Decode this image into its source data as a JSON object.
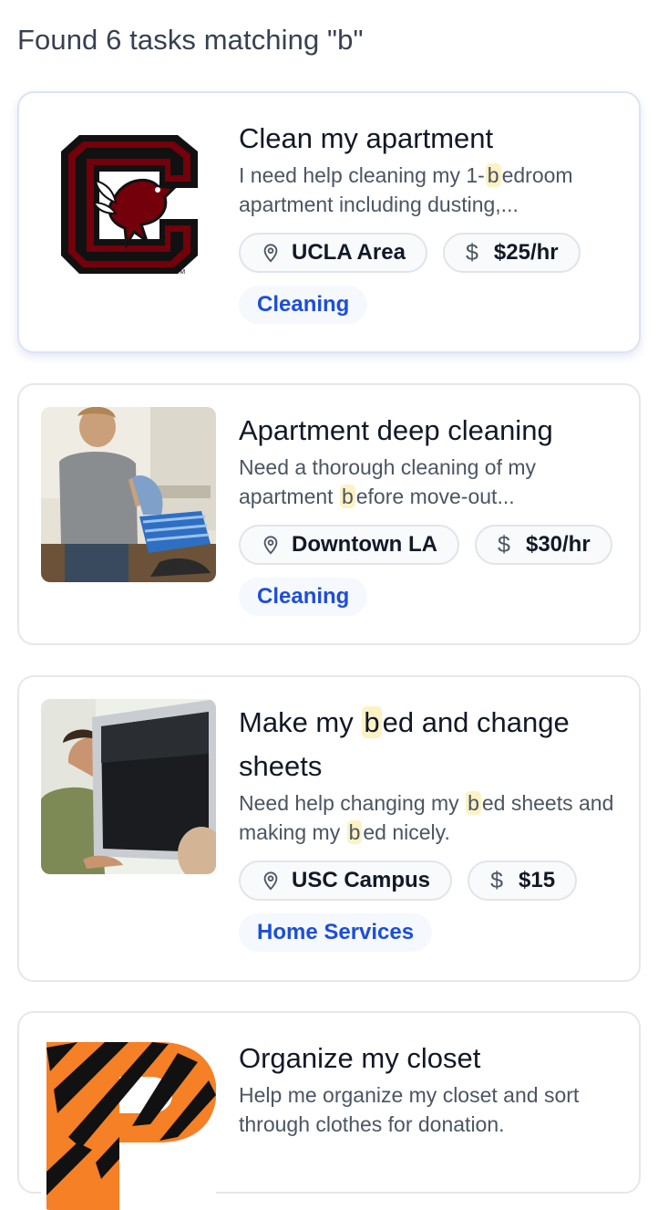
{
  "results": {
    "header": "Found 6 tasks matching \"b\""
  },
  "tasks": [
    {
      "title": "Clean my apartment",
      "desc_before": "I need help cleaning my 1-",
      "desc_hl": "b",
      "desc_after": "edroom apartment including dusting,...",
      "location": "UCLA Area",
      "rate": "$25/hr",
      "category": "Cleaning",
      "image": "gamecocks-logo"
    },
    {
      "title": "Apartment deep cleaning",
      "desc_before": "Need a thorough cleaning of my apartment ",
      "desc_hl": "b",
      "desc_after": "efore move-out...",
      "location": "Downtown LA",
      "rate": "$30/hr",
      "category": "Cleaning",
      "image": "man-doing-laundry-photo"
    },
    {
      "title_before": "Make my ",
      "title_hl": "b",
      "title_after": "ed and change sheets",
      "desc_1": "Need help changing my ",
      "desc_hl1": "b",
      "desc_2": "ed sheets and making my ",
      "desc_hl2": "b",
      "desc_3": "ed nicely.",
      "location": "USC Campus",
      "rate": "$15",
      "category": "Home Services",
      "image": "man-carrying-tv-photo"
    },
    {
      "title": "Organize my closet",
      "desc": "Help me organize my closet and sort through clothes for donation.",
      "image": "princeton-tiger-logo"
    }
  ],
  "icons": {
    "location": "map-pin-icon",
    "price": "dollar-icon"
  },
  "colors": {
    "category_text": "#1d4ed8",
    "highlight": "#fdf2c4"
  },
  "symbols": {
    "dollar": "$"
  }
}
